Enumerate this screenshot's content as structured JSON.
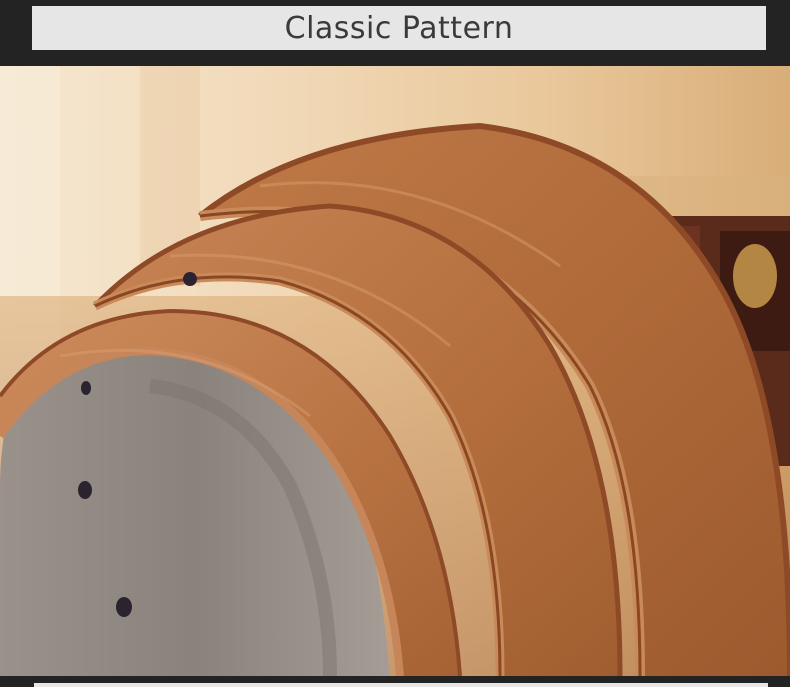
{
  "header": {
    "title": "Classic Pattern"
  },
  "photo": {
    "subject_icon": "leather-belt-photo",
    "colors": {
      "leather": "#b46a3a",
      "edge": "#8e4a26",
      "inner": "#8f8883",
      "background_light": "#f3dfc2",
      "background_warm": "#c9965c",
      "background_dark": "#4a2418"
    }
  }
}
